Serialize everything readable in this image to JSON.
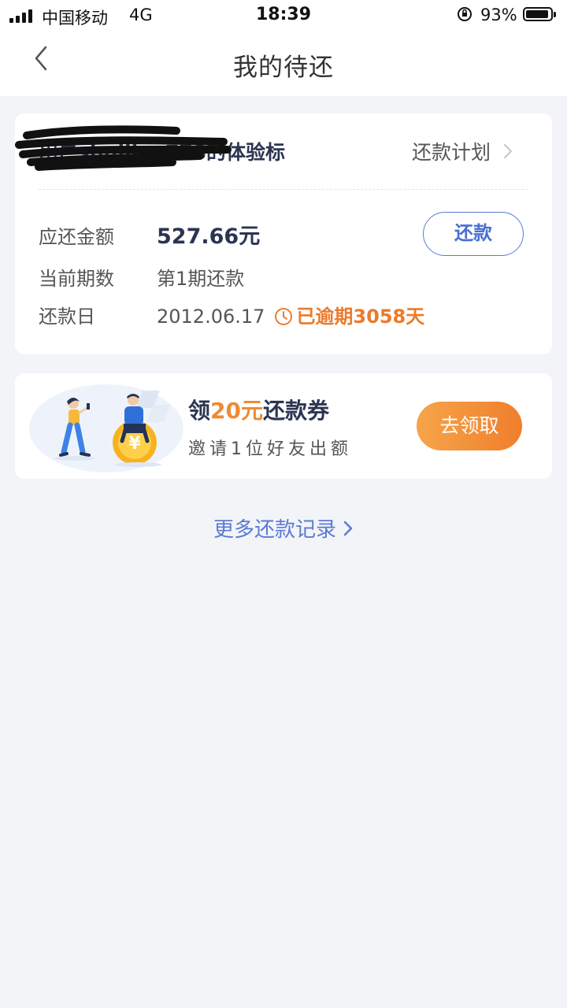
{
  "status_bar": {
    "carrier": "中国移动",
    "network": "4G",
    "time": "18:39",
    "battery_percent": "93%",
    "battery_level": 0.93
  },
  "nav": {
    "title": "我的待还",
    "back_icon": "chevron-left-icon"
  },
  "loan": {
    "name": "用户shuijian778的体验标",
    "plan_label": "还款计划",
    "amount_label": "应还金额",
    "amount_value": "527.66元",
    "period_label": "当前期数",
    "period_value": "第1期还款",
    "due_label": "还款日",
    "due_value": "2012.06.17",
    "overdue_text": "已逾期3058天",
    "repay_button": "还款",
    "colors": {
      "overdue": "#ed7a2b",
      "accent": "#4a6fd3"
    }
  },
  "promo": {
    "title_prefix": "领",
    "title_amount": "20元",
    "title_suffix": "还款券",
    "subtitle": "邀请1位好友出额",
    "claim_button": "去领取",
    "colors": {
      "button_start": "#f6a54a",
      "button_end": "#f07e2c"
    }
  },
  "more_records": {
    "label": "更多还款记录"
  }
}
